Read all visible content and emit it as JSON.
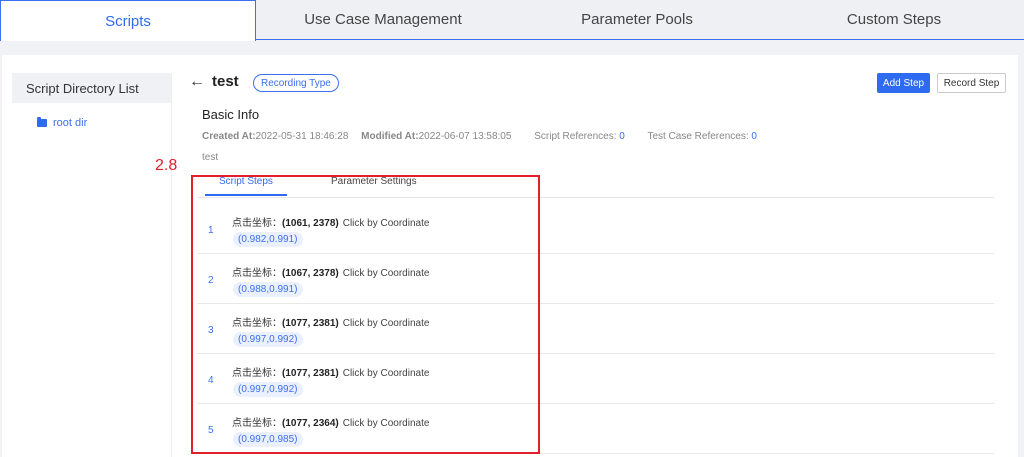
{
  "top_tabs": [
    {
      "label": "Scripts",
      "active": true
    },
    {
      "label": "Use Case Management",
      "active": false
    },
    {
      "label": "Parameter Pools",
      "active": false
    },
    {
      "label": "Custom Steps",
      "active": false
    }
  ],
  "sidebar": {
    "title": "Script Directory List",
    "tree": [
      {
        "label": "root dir",
        "icon": "folder-icon"
      }
    ]
  },
  "header": {
    "back_icon": "←",
    "title": "test",
    "type_badge": "Recording Type",
    "add_step_label": "Add Step",
    "record_step_label": "Record Step"
  },
  "basic_info": {
    "section_title": "Basic Info",
    "created_label": "Created At:",
    "created_value": "2022-05-31 18:46:28",
    "modified_label": "Modified At:",
    "modified_value": "2022-06-07 13:58:05",
    "script_refs_label": "Script References:",
    "script_refs_value": "0",
    "case_refs_label": "Test Case References:",
    "case_refs_value": "0",
    "description": "test"
  },
  "annotation": "2.8",
  "inner_tabs": [
    {
      "label": "Script Steps",
      "active": true
    },
    {
      "label": "Parameter Settings",
      "active": false
    }
  ],
  "steps": [
    {
      "num": "1",
      "prefix": "点击坐标：",
      "coord": "(1061, 2378)",
      "action": "Click by Coordinate",
      "ratio": "(0.982,0.991)"
    },
    {
      "num": "2",
      "prefix": "点击坐标：",
      "coord": "(1067, 2378)",
      "action": "Click by Coordinate",
      "ratio": "(0.988,0.991)"
    },
    {
      "num": "3",
      "prefix": "点击坐标：",
      "coord": "(1077, 2381)",
      "action": "Click by Coordinate",
      "ratio": "(0.997,0.992)"
    },
    {
      "num": "4",
      "prefix": "点击坐标：",
      "coord": "(1077, 2381)",
      "action": "Click by Coordinate",
      "ratio": "(0.997,0.992)"
    },
    {
      "num": "5",
      "prefix": "点击坐标：",
      "coord": "(1077, 2364)",
      "action": "Click by Coordinate",
      "ratio": "(0.997,0.985)"
    }
  ],
  "colors": {
    "accent": "#2f6bf0",
    "annotation": "#e0202a"
  }
}
